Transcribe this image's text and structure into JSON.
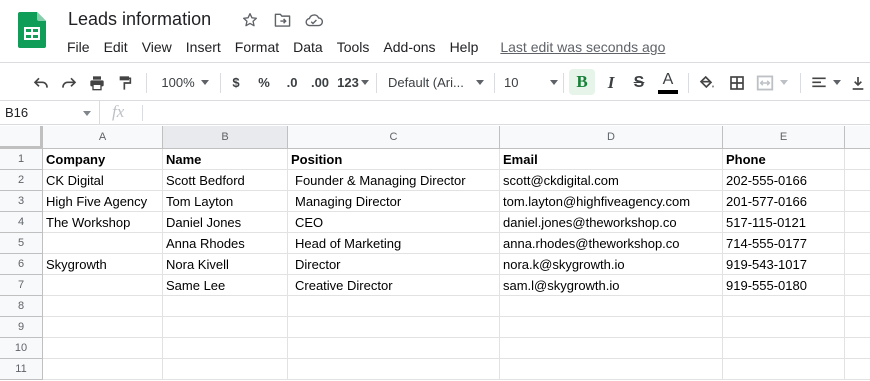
{
  "app": {
    "title": "Leads information",
    "icons": [
      "star-icon",
      "move-to-folder-icon",
      "cloud-status-icon"
    ],
    "brand_color": "#0f9d58"
  },
  "menu": {
    "items": [
      "File",
      "Edit",
      "View",
      "Insert",
      "Format",
      "Data",
      "Tools",
      "Add-ons",
      "Help"
    ],
    "last_edit": "Last edit was seconds ago"
  },
  "toolbar": {
    "zoom": "100%",
    "currency": "$",
    "percent": "%",
    "decrease_decimal": ".0",
    "increase_decimal": ".00",
    "more_formats": "123",
    "font_family": "Default (Ari...",
    "font_size": "10",
    "bold": "B",
    "italic": "I",
    "strikethrough": "S",
    "text_color_letter": "A",
    "text_color": "#000000",
    "bold_active_bg": "#e6f4ea"
  },
  "formula_bar": {
    "cell_ref": "B16",
    "fx": "fx",
    "value": ""
  },
  "sheet": {
    "columns": [
      "A",
      "B",
      "C",
      "D",
      "E"
    ],
    "row_numbers": [
      "1",
      "2",
      "3",
      "4",
      "5",
      "6",
      "7",
      "8",
      "9",
      "10",
      "11"
    ],
    "rows": [
      [
        "Company",
        "Name",
        "Position",
        "Email",
        "Phone"
      ],
      [
        "CK Digital",
        "Scott Bedford",
        "Founder & Managing Director",
        "scott@ckdigital.com",
        "202-555-0166"
      ],
      [
        "High Five Agency",
        "Tom Layton",
        "Managing Director",
        "tom.layton@highfiveagency.com",
        "201-577-0166"
      ],
      [
        "The Workshop",
        "Daniel Jones",
        "CEO",
        "daniel.jones@theworkshop.co",
        "517-115-0121"
      ],
      [
        "",
        "Anna Rhodes",
        "Head of Marketing",
        "anna.rhodes@theworkshop.co",
        "714-555-0177"
      ],
      [
        "Skygrowth",
        "Nora Kivell",
        "Director",
        "nora.k@skygrowth.io",
        "919-543-1017"
      ],
      [
        "",
        "Same Lee",
        "Creative Director",
        "sam.l@skygrowth.io",
        "919-555-0180"
      ],
      [
        "",
        "",
        "",
        "",
        ""
      ],
      [
        "",
        "",
        "",
        "",
        ""
      ],
      [
        "",
        "",
        "",
        "",
        ""
      ],
      [
        "",
        "",
        "",
        "",
        ""
      ]
    ]
  }
}
